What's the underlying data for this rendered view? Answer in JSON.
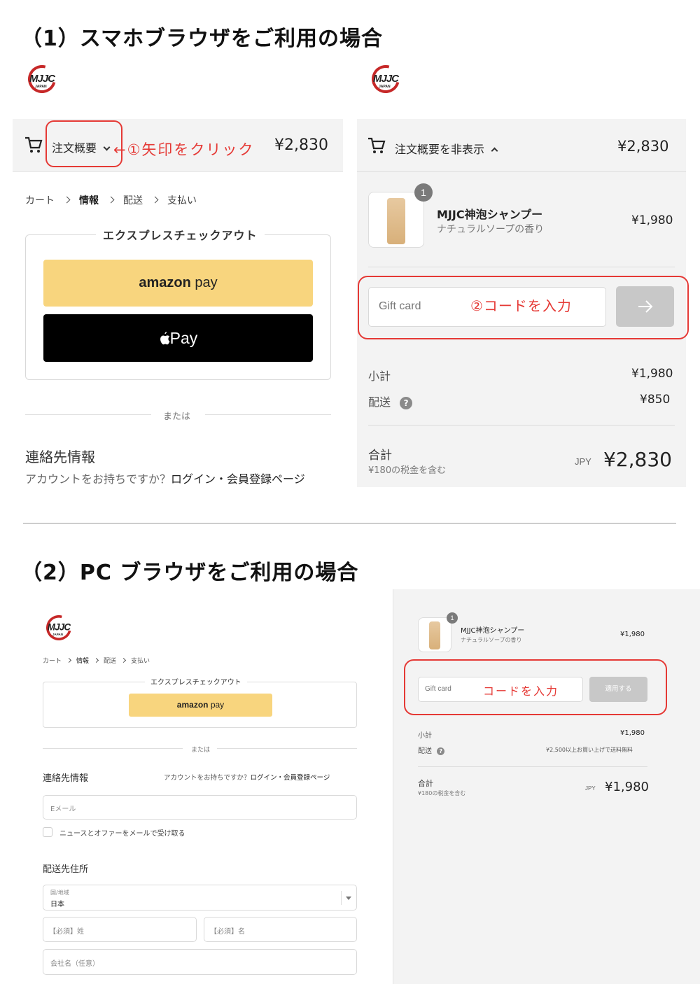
{
  "section1": {
    "title": "（1）スマホブラウザをご利用の場合",
    "logo_text": "MJJC",
    "logo_sub": "JAPAN",
    "left": {
      "order_summary_label": "注文概要",
      "annotation": "←①矢印をクリック",
      "total": "¥2,830",
      "breadcrumb": [
        "カート",
        "情報",
        "配送",
        "支払い"
      ],
      "express_title": "エクスプレスチェックアウト",
      "amazon_pay": {
        "brand": "amazon",
        "suffix": "pay"
      },
      "apple_pay": {
        "symbol": "",
        "label": "Pay"
      },
      "or_label": "または",
      "contact_title": "連絡先情報",
      "account_question": "アカウントをお持ちですか？",
      "login_link": "ログイン・会員登録ページ"
    },
    "right": {
      "hide_summary_label": "注文概要を非表示",
      "total": "¥2,830",
      "product": {
        "qty": "1",
        "name": "MJJC神泡シャンプー",
        "variant": "ナチュラルソープの香り",
        "price": "¥1,980"
      },
      "gift_card_placeholder": "Gift card",
      "annotation": "②コードを入力",
      "subtotal_label": "小計",
      "subtotal_value": "¥1,980",
      "shipping_label": "配送",
      "shipping_value": "¥850",
      "total_label": "合計",
      "tax_note": "¥180の税金を含む",
      "currency": "JPY",
      "grand_total": "¥2,830"
    }
  },
  "section2": {
    "title": "（2）PC ブラウザをご利用の場合",
    "left": {
      "breadcrumb": [
        "カート",
        "情報",
        "配送",
        "支払い"
      ],
      "express_title": "エクスプレスチェックアウト",
      "amazon_pay": {
        "brand": "amazon",
        "suffix": "pay"
      },
      "or_label": "または",
      "contact_title": "連絡先情報",
      "account_question": "アカウントをお持ちですか？",
      "login_link": "ログイン・会員登録ページ",
      "email_placeholder": "Eメール",
      "newsletter_label": "ニュースとオファーをメールで受け取る",
      "shipping_title": "配送先住所",
      "country_label": "国/地域",
      "country_value": "日本",
      "last_name_placeholder": "【必須】姓",
      "first_name_placeholder": "【必須】名",
      "company_placeholder": "会社名（任意）"
    },
    "right": {
      "product": {
        "qty": "1",
        "name": "MJJC神泡シャンプー",
        "variant": "ナチュラルソープの香り",
        "price": "¥1,980"
      },
      "gift_card_placeholder": "Gift card",
      "annotation": "コードを入力",
      "apply_button": "適用する",
      "subtotal_label": "小計",
      "subtotal_value": "¥1,980",
      "shipping_label": "配送",
      "shipping_note": "¥2,500以上お買い上げで送料無料",
      "total_label": "合計",
      "tax_note": "¥180の税金を含む",
      "currency": "JPY",
      "grand_total": "¥1,980"
    }
  },
  "colors": {
    "annotation_red": "#e53935",
    "amazon_yellow": "#f8d57e",
    "apple_black": "#000000",
    "panel_gray": "#f3f3f3",
    "disabled_button": "#c8c8c8"
  }
}
